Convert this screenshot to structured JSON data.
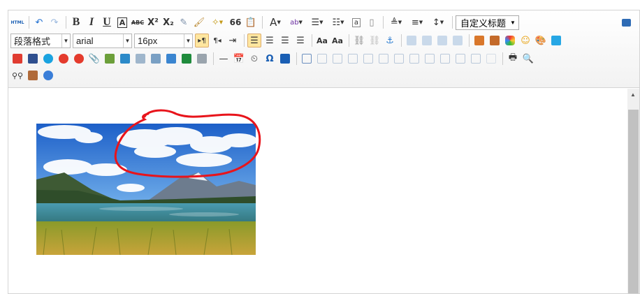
{
  "toolbar": {
    "html_label": "HTML",
    "paragraph_format": "段落格式",
    "font_family": "arial",
    "font_size": "16px",
    "custom_title": "自定义标题",
    "bold": "B",
    "italic": "I",
    "underline": "U",
    "quote": "66",
    "omega": "Ω"
  },
  "content": {
    "image_alt": "mountain lake landscape photo with clouds",
    "annotation": "red hand-drawn circle around clouds"
  },
  "colors": {
    "annotation": "#e8141b",
    "highlight": "#ffe69f"
  }
}
